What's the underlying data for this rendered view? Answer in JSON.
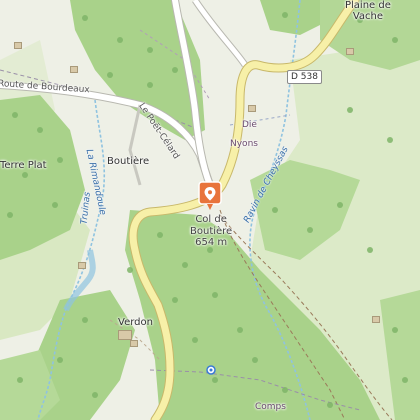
{
  "map": {
    "places": {
      "plaine_de_vache_line1": "Plaine de",
      "plaine_de_vache_line2": "Vache",
      "boutiere": "Boutière",
      "verdon": "Verdon",
      "terre_plat": "Terre Plat",
      "col_line1": "Col de",
      "col_line2": "Boutière",
      "col_elevation": "654 m"
    },
    "roads": {
      "d538_shield": "D 538",
      "route_de_bourdeaux": "Route de Bourdeaux",
      "le_poet_celard": "Le Poët-Célard",
      "die": "Die",
      "nyons": "Nyons",
      "comps": "Comps"
    },
    "water": {
      "ravin_de_cheyssas": "Ravin de Cheyssas",
      "la_rimandoule": "La Rimandoule",
      "truinas": "Truinas"
    },
    "colors": {
      "forest": "#a9d28a",
      "meadow": "#dceac8",
      "bare": "#eef0e6",
      "road_fill": "#ffffff",
      "road_outline": "#b8b8b0",
      "major_road_fill": "#f7f0a8",
      "stream": "#8fc3e0",
      "marker": "#e8743b"
    },
    "icons": {
      "marker": "map-pin-icon",
      "trees": "tree-icon",
      "hamlet": "building-icon"
    }
  }
}
